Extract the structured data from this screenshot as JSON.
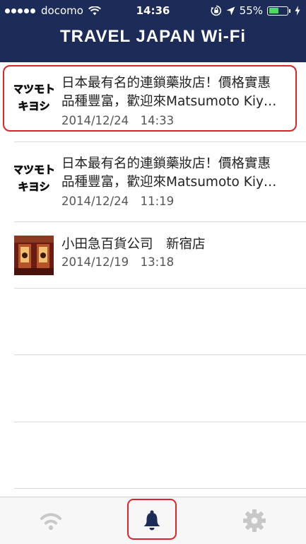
{
  "status_bar": {
    "carrier": "docomo",
    "time": "14:36",
    "battery": "55%",
    "battery_level": 0.55
  },
  "header": {
    "title": "TRAVEL JAPAN Wi-Fi"
  },
  "notifications": [
    {
      "thumbnail": "matsumoto-kiyoshi-logo",
      "logo_text": [
        "マツモト",
        "キヨシ"
      ],
      "title_line1": "日本最有名的連鎖藥妝店！價格實惠",
      "title_line2": "品種豐富，歡迎來Matsumoto Kiy…",
      "date": "2014/12/24　14:33",
      "highlighted": true
    },
    {
      "thumbnail": "matsumoto-kiyoshi-logo",
      "logo_text": [
        "マツモト",
        "キヨシ"
      ],
      "title_line1": "日本最有名的連鎖藥妝店！價格實惠",
      "title_line2": "品種豐富，歡迎來Matsumoto Kiy…",
      "date": "2014/12/24　11:19",
      "highlighted": false
    },
    {
      "thumbnail": "odakyu-store-photo",
      "title_line1": "小田急百貨公司　新宿店",
      "date": "2014/12/19　13:18",
      "highlighted": false
    }
  ],
  "tab_bar": {
    "tabs": [
      {
        "icon": "wifi-icon",
        "active": false
      },
      {
        "icon": "bell-icon",
        "active": true
      },
      {
        "icon": "gear-icon",
        "active": false
      }
    ]
  },
  "colors": {
    "header_bg": "#1c2b57",
    "logo_yellow": "#f5d60a",
    "highlight_red": "#d9252b",
    "active_tab": "#1c2b57",
    "inactive_tab": "#c8c8c8"
  }
}
